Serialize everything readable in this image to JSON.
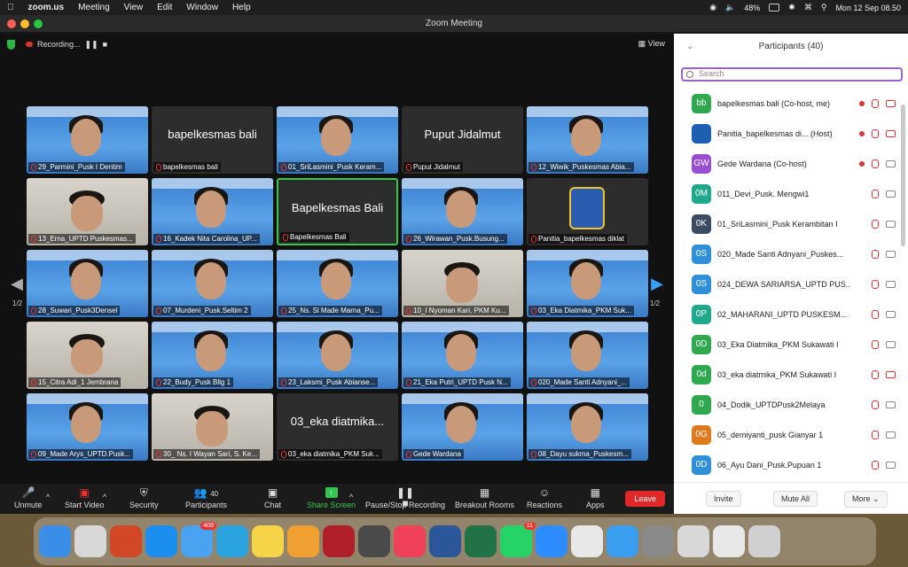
{
  "menubar": {
    "app": "zoom.us",
    "items": [
      "Meeting",
      "View",
      "Edit",
      "Window",
      "Help"
    ],
    "battery": "48%",
    "clock": "Mon 12 Sep  08.50"
  },
  "window": {
    "title": "Zoom Meeting",
    "recording_label": "Recording...",
    "view_label": "View",
    "page_left": "1/2",
    "page_right": "1/2"
  },
  "tiles": [
    {
      "kind": "cam",
      "label": "29_Parmini_Pusk I Dentim"
    },
    {
      "kind": "name",
      "big": "bapelkesmas bali",
      "label": "bapelkesmas bali"
    },
    {
      "kind": "cam",
      "label": "01_SriLasmini_Pusk Keram..."
    },
    {
      "kind": "name",
      "big": "Puput Jidalmut",
      "label": "Puput Jidalmut"
    },
    {
      "kind": "cam",
      "label": "12_Wiwik_Puskesmas Abia..."
    },
    {
      "kind": "room",
      "label": "13_Erna_UPTD Puskesmas..."
    },
    {
      "kind": "cam",
      "label": "16_Kadek Nita Carolina_UP..."
    },
    {
      "kind": "active",
      "big": "Bapelkesmas Bali",
      "label": "Bapelkesmas Bali"
    },
    {
      "kind": "cam",
      "label": "26_Wirawan_Pusk.Busung..."
    },
    {
      "kind": "logo",
      "label": "Panitia_bapelkesmas diklat"
    },
    {
      "kind": "cam",
      "label": "28_Suwari_Pusk3Densel"
    },
    {
      "kind": "cam",
      "label": "07_Murdeni_Pusk.Seltim 2"
    },
    {
      "kind": "cam",
      "label": "25_Ns. Si Made Marna_Pu..."
    },
    {
      "kind": "room",
      "label": "10_I Nyoman Kari, PKM Ku..."
    },
    {
      "kind": "cam",
      "label": "03_Eka Diatmika_PKM Suk..."
    },
    {
      "kind": "room",
      "label": "15_Citra Adi_1 Jembrana"
    },
    {
      "kind": "cam",
      "label": "22_Budy_Pusk Bllg 1"
    },
    {
      "kind": "cam",
      "label": "23_Laksmi_Pusk Abianse..."
    },
    {
      "kind": "cam",
      "label": "21_Eka Putri_UPTD Pusk N..."
    },
    {
      "kind": "cam",
      "label": "020_Made Santi Adnyani_..."
    },
    {
      "kind": "cam",
      "label": "09_Made Arys_UPTD.Pusk..."
    },
    {
      "kind": "room",
      "label": "30_ Ns. I Wayan Sari, S. Ke..."
    },
    {
      "kind": "name",
      "big": "03_eka diatmika...",
      "label": "03_eka diatmika_PKM Suk..."
    },
    {
      "kind": "cam",
      "label": "Gede Wardana"
    },
    {
      "kind": "cam",
      "label": "08_Dayu sukma_Puskesm..."
    }
  ],
  "toolbar": {
    "unmute": "Unmute",
    "start_video": "Start Video",
    "security": "Security",
    "participants": "Participants",
    "participants_count": "40",
    "chat": "Chat",
    "share_screen": "Share Screen",
    "pause_recording": "Pause/Stop Recording",
    "breakout": "Breakout Rooms",
    "reactions": "Reactions",
    "apps": "Apps",
    "leave": "Leave"
  },
  "panel": {
    "title": "Participants (40)",
    "search_placeholder": "Search",
    "invite": "Invite",
    "mute_all": "Mute All",
    "more": "More",
    "participants": [
      {
        "initials": "bb",
        "color": "#2fa84f",
        "name": "bapelkesmas bali (Co-host, me)",
        "rec": true,
        "cam_off": true
      },
      {
        "initials": "",
        "color": "#1d5fb0",
        "name": "Panitia_bapelkesmas di...   (Host)",
        "rec": true,
        "cam_off": true
      },
      {
        "initials": "GW",
        "color": "#9a4fd0",
        "name": "Gede Wardana (Co-host)",
        "rec": true,
        "cam_off": false
      },
      {
        "initials": "0M",
        "color": "#1fa88c",
        "name": "011_Devi_Pusk. Mengwi1",
        "rec": false,
        "cam_off": false
      },
      {
        "initials": "0K",
        "color": "#3b4c62",
        "name": "01_SriLasmini_Pusk Kerambitan I",
        "rec": false,
        "cam_off": false
      },
      {
        "initials": "0S",
        "color": "#2f8fd9",
        "name": "020_Made Santi Adnyani_Puskes...",
        "rec": false,
        "cam_off": false
      },
      {
        "initials": "0S",
        "color": "#2f8fd9",
        "name": "024_DEWA SARIARSA_UPTD PUS...",
        "rec": false,
        "cam_off": false
      },
      {
        "initials": "0P",
        "color": "#1fa88c",
        "name": "02_MAHARANI_UPTD PUSKESM...",
        "rec": false,
        "cam_off": false
      },
      {
        "initials": "0D",
        "color": "#2fa84f",
        "name": "03_Eka Diatmika_PKM Sukawati I",
        "rec": false,
        "cam_off": false
      },
      {
        "initials": "0d",
        "color": "#2fa84f",
        "name": "03_eka diatmika_PKM Sukawati I",
        "rec": false,
        "cam_off": true
      },
      {
        "initials": "0",
        "color": "#2fa84f",
        "name": "04_Dodik_UPTDPusk2Melaya",
        "rec": false,
        "cam_off": false
      },
      {
        "initials": "0G",
        "color": "#e07a1f",
        "name": "05_demiyanti_pusk Gianyar 1",
        "rec": false,
        "cam_off": false
      },
      {
        "initials": "0D",
        "color": "#2f8fd9",
        "name": "06_Ayu Dani_Pusk.Pupuan 1",
        "rec": false,
        "cam_off": false
      }
    ]
  },
  "dock": {
    "mail_badge": "408",
    "whatsapp_badge": "11",
    "apps": [
      {
        "name": "finder-icon",
        "color": "#3a8ee8"
      },
      {
        "name": "launchpad-icon",
        "color": "#d8d8d8"
      },
      {
        "name": "powerpoint-icon",
        "color": "#d24726"
      },
      {
        "name": "appstore-icon",
        "color": "#1c8ef0"
      },
      {
        "name": "mail-icon",
        "color": "#4aa3f0"
      },
      {
        "name": "telegram-icon",
        "color": "#2aa3e0"
      },
      {
        "name": "notes-icon",
        "color": "#f5d547"
      },
      {
        "name": "photos-icon",
        "color": "#f0a030"
      },
      {
        "name": "mendeley-icon",
        "color": "#b01f2a"
      },
      {
        "name": "quicktime-icon",
        "color": "#4a4a4a"
      },
      {
        "name": "music-icon",
        "color": "#f0405a"
      },
      {
        "name": "word-icon",
        "color": "#2b579a"
      },
      {
        "name": "excel-icon",
        "color": "#217346"
      },
      {
        "name": "whatsapp-icon",
        "color": "#25d366"
      },
      {
        "name": "zoom-icon",
        "color": "#2d8cff"
      },
      {
        "name": "chrome-icon",
        "color": "#e8e8e8"
      },
      {
        "name": "safari-icon",
        "color": "#3a9ef0"
      },
      {
        "name": "settings-icon",
        "color": "#8a8a8a"
      },
      {
        "name": "preview-icon",
        "color": "#d8d8d8"
      },
      {
        "name": "downloads-icon",
        "color": "#e8e8e8"
      },
      {
        "name": "trash-icon",
        "color": "#d0d0d0"
      }
    ]
  }
}
